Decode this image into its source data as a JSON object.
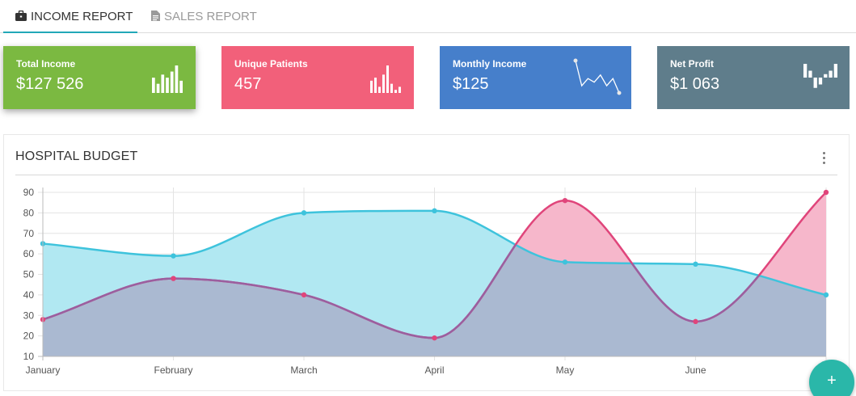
{
  "tabs": [
    {
      "label": "INCOME REPORT",
      "icon": "briefcase-icon",
      "active": true
    },
    {
      "label": "SALES REPORT",
      "icon": "document-icon",
      "active": false
    }
  ],
  "cards": [
    {
      "label": "Total Income",
      "value": "$127 526",
      "color": "#7bb941",
      "spark_type": "bar",
      "spark": [
        5,
        3,
        6,
        5,
        7,
        9,
        4
      ]
    },
    {
      "label": "Unique Patients",
      "value": "457",
      "color": "#f2607a",
      "spark_type": "bar",
      "spark": [
        4,
        5,
        2,
        6,
        9,
        3,
        1,
        2
      ]
    },
    {
      "label": "Monthly Income",
      "value": "$125",
      "color": "#467fcb",
      "spark_type": "line",
      "spark": [
        10,
        3,
        5,
        4,
        6,
        3,
        5,
        1
      ]
    },
    {
      "label": "Net Profit",
      "value": "$1 063",
      "color": "#5f7d8b",
      "spark_type": "winloss",
      "spark": [
        4,
        2,
        -3,
        -2,
        1,
        2,
        4
      ]
    }
  ],
  "panel": {
    "title": "HOSPITAL BUDGET",
    "menu_icon": "more-vertical-icon"
  },
  "chart_data": {
    "type": "area",
    "categories": [
      "January",
      "February",
      "March",
      "April",
      "May",
      "June",
      ""
    ],
    "ylim": [
      10,
      90
    ],
    "yticks": [
      10,
      20,
      30,
      40,
      50,
      60,
      70,
      80,
      90
    ],
    "grid": true,
    "series": [
      {
        "values": [
          65,
          59,
          80,
          81,
          56,
          55,
          40
        ],
        "color": "#3ec3dc",
        "fill": "#b1e8f2"
      },
      {
        "values": [
          28,
          48,
          40,
          19,
          86,
          27,
          90
        ],
        "color": "#e0457b",
        "fill": "#f6b7cb"
      }
    ],
    "overlap_fill": "#aab9d1"
  },
  "fab": {
    "label": "+"
  }
}
